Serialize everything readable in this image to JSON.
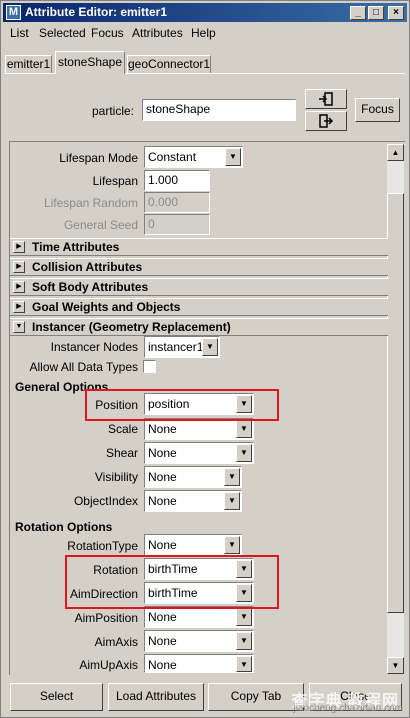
{
  "window": {
    "title": "Attribute Editor: emitter1",
    "controls": {
      "minimize": "_",
      "maximize": "□",
      "close": "×"
    }
  },
  "menu": [
    "List",
    "Selected",
    "Focus",
    "Attributes",
    "Help"
  ],
  "tabs": [
    {
      "label": "emitter1",
      "active": false
    },
    {
      "label": "stoneShape",
      "active": true
    },
    {
      "label": "geoConnector1",
      "active": false
    }
  ],
  "header": {
    "particle_label": "particle:",
    "particle_value": "stoneShape",
    "focus_label": "Focus",
    "icon_load": "input-arrow-icon",
    "icon_output": "output-arrow-icon"
  },
  "lifespan": {
    "mode_label": "Lifespan Mode",
    "mode_value": "Constant",
    "lifespan_label": "Lifespan",
    "lifespan_value": "1.000",
    "random_label": "Lifespan Random",
    "random_value": "0.000",
    "seed_label": "General Seed",
    "seed_value": "0"
  },
  "sections": {
    "time": "Time Attributes",
    "collision": "Collision Attributes",
    "soft_body": "Soft Body Attributes",
    "goal": "Goal Weights and Objects",
    "instancer": "Instancer (Geometry Replacement)"
  },
  "instancer": {
    "nodes_label": "Instancer Nodes",
    "nodes_value": "instancer1",
    "allow_label": "Allow All Data Types",
    "allow_checked": false
  },
  "general_options": {
    "heading": "General Options",
    "rows": [
      {
        "label": "Position",
        "value": "position"
      },
      {
        "label": "Scale",
        "value": "None"
      },
      {
        "label": "Shear",
        "value": "None"
      },
      {
        "label": "Visibility",
        "value": "None"
      },
      {
        "label": "ObjectIndex",
        "value": "None"
      }
    ]
  },
  "rotation_options": {
    "heading": "Rotation Options",
    "rows": [
      {
        "label": "RotationType",
        "value": "None"
      },
      {
        "label": "Rotation",
        "value": "birthTime"
      },
      {
        "label": "AimDirection",
        "value": "birthTime"
      },
      {
        "label": "AimPosition",
        "value": "None"
      },
      {
        "label": "AimAxis",
        "value": "None"
      },
      {
        "label": "AimUpAxis",
        "value": "None"
      }
    ]
  },
  "bottom_buttons": {
    "select": "Select",
    "load": "Load Attributes",
    "copy": "Copy Tab",
    "close": "Close"
  },
  "watermark": {
    "big": "查字典 教程网",
    "small": "jiaocheng.chazidian.com"
  },
  "colors": {
    "window_bg": "#d4d0c8",
    "title_start": "#0a246a",
    "title_end": "#3a6ea5",
    "highlight_box": "#e0151c"
  }
}
